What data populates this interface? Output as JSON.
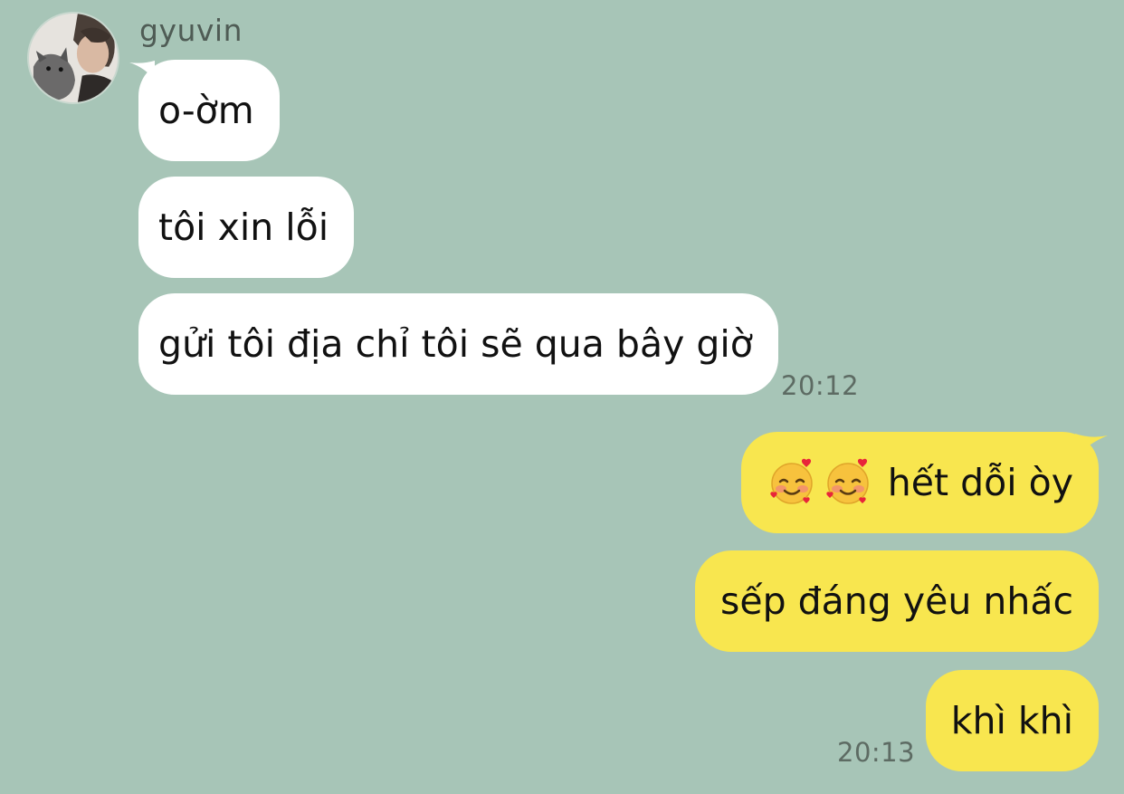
{
  "chat": {
    "sender_name": "gyuvin",
    "incoming": [
      {
        "text": "o-ờm"
      },
      {
        "text": "tôi xin lỗi"
      },
      {
        "text": "gửi tôi địa chỉ tôi sẽ qua bây giờ"
      }
    ],
    "incoming_time": "20:12",
    "outgoing": [
      {
        "emoji": [
          "smiling-face-with-hearts",
          "smiling-face-with-hearts"
        ],
        "text": "hết dỗi òy"
      },
      {
        "text": "sếp đáng yêu nhấc"
      },
      {
        "text": "khì khì"
      }
    ],
    "outgoing_time": "20:13"
  },
  "colors": {
    "background": "#a7c5b7",
    "incoming_bubble": "#ffffff",
    "outgoing_bubble": "#f8e64f",
    "timestamp": "#5d6b63"
  }
}
